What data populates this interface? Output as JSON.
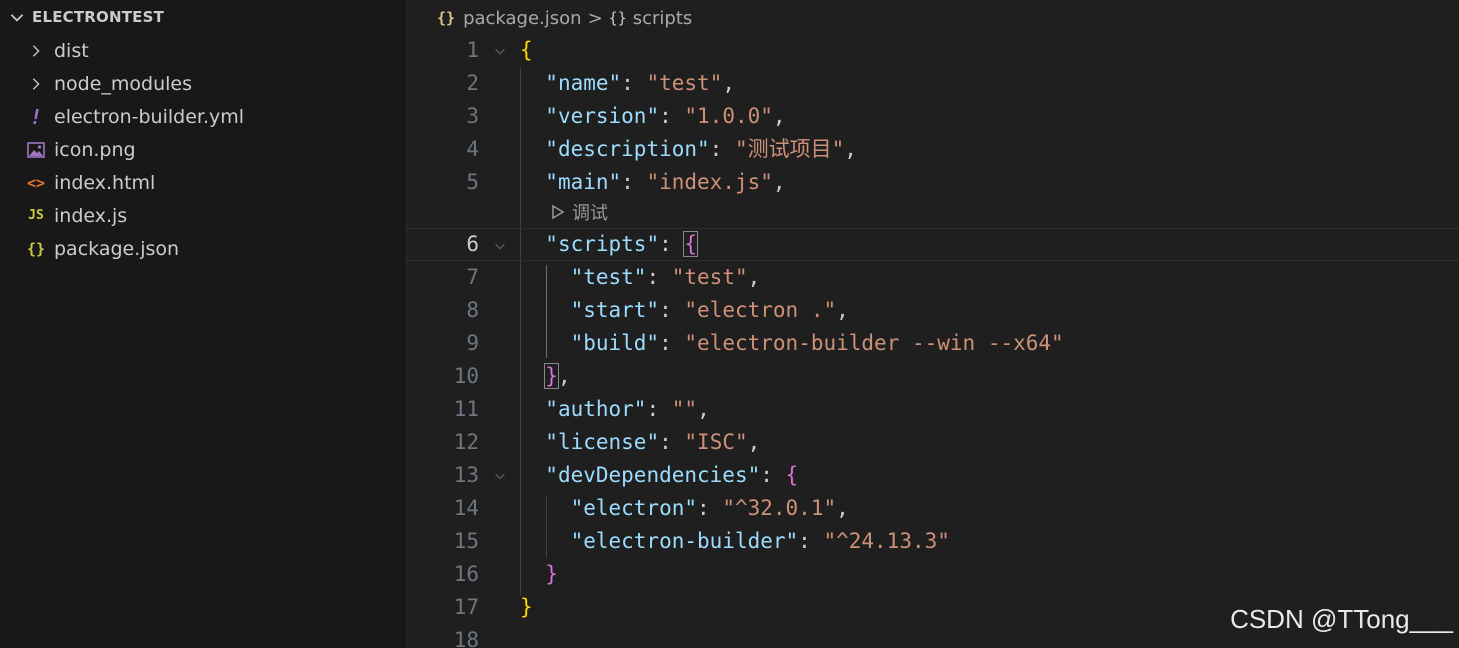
{
  "explorer": {
    "title": "ELECTRONTEST",
    "items": [
      {
        "label": "dist",
        "icon": "chevron-right-icon",
        "kind": "folder",
        "icon_text": ">"
      },
      {
        "label": "node_modules",
        "icon": "chevron-right-icon",
        "kind": "folder",
        "icon_text": ">"
      },
      {
        "label": "electron-builder.yml",
        "icon": "yaml-file-icon",
        "kind": "file",
        "icon_text": "!"
      },
      {
        "label": "icon.png",
        "icon": "image-file-icon",
        "kind": "file",
        "icon_text": ""
      },
      {
        "label": "index.html",
        "icon": "html-file-icon",
        "kind": "file",
        "icon_text": "<>"
      },
      {
        "label": "index.js",
        "icon": "js-file-icon",
        "kind": "file",
        "icon_text": "JS"
      },
      {
        "label": "package.json",
        "icon": "json-file-icon",
        "kind": "file",
        "icon_text": "{}"
      }
    ]
  },
  "breadcrumb": {
    "file_icon": "{}",
    "file": "package.json",
    "separator": ">",
    "symbol_icon": "{}",
    "symbol": "scripts"
  },
  "codelens": {
    "label": "调试"
  },
  "editor": {
    "lines": [
      {
        "n": "1",
        "text": "{"
      },
      {
        "n": "2",
        "text": "  \"name\": \"test\","
      },
      {
        "n": "3",
        "text": "  \"version\": \"1.0.0\","
      },
      {
        "n": "4",
        "text": "  \"description\": \"测试项目\","
      },
      {
        "n": "5",
        "text": "  \"main\": \"index.js\","
      },
      {
        "n": "6",
        "text": "  \"scripts\": {"
      },
      {
        "n": "7",
        "text": "    \"test\": \"test\","
      },
      {
        "n": "8",
        "text": "    \"start\": \"electron .\","
      },
      {
        "n": "9",
        "text": "    \"build\": \"electron-builder --win --x64\""
      },
      {
        "n": "10",
        "text": "  },"
      },
      {
        "n": "11",
        "text": "  \"author\": \"\","
      },
      {
        "n": "12",
        "text": "  \"license\": \"ISC\","
      },
      {
        "n": "13",
        "text": "  \"devDependencies\": {"
      },
      {
        "n": "14",
        "text": "    \"electron\": \"^32.0.1\","
      },
      {
        "n": "15",
        "text": "    \"electron-builder\": \"^24.13.3\""
      },
      {
        "n": "16",
        "text": "  }"
      },
      {
        "n": "17",
        "text": "}"
      },
      {
        "n": "18",
        "text": ""
      }
    ]
  },
  "watermark": "CSDN @TTong___",
  "colors": {
    "editor_bg": "#1f1f1f",
    "sidebar_bg": "#181818",
    "json_key": "#9cdcfe",
    "json_string": "#ce9178",
    "bracket_level1": "#ffd700",
    "bracket_level2": "#da70d6",
    "line_number": "#6e7681",
    "json_icon": "#e2c08d",
    "html_icon": "#e37933",
    "js_icon": "#cbcb41",
    "yaml_icon": "#a074c4"
  }
}
